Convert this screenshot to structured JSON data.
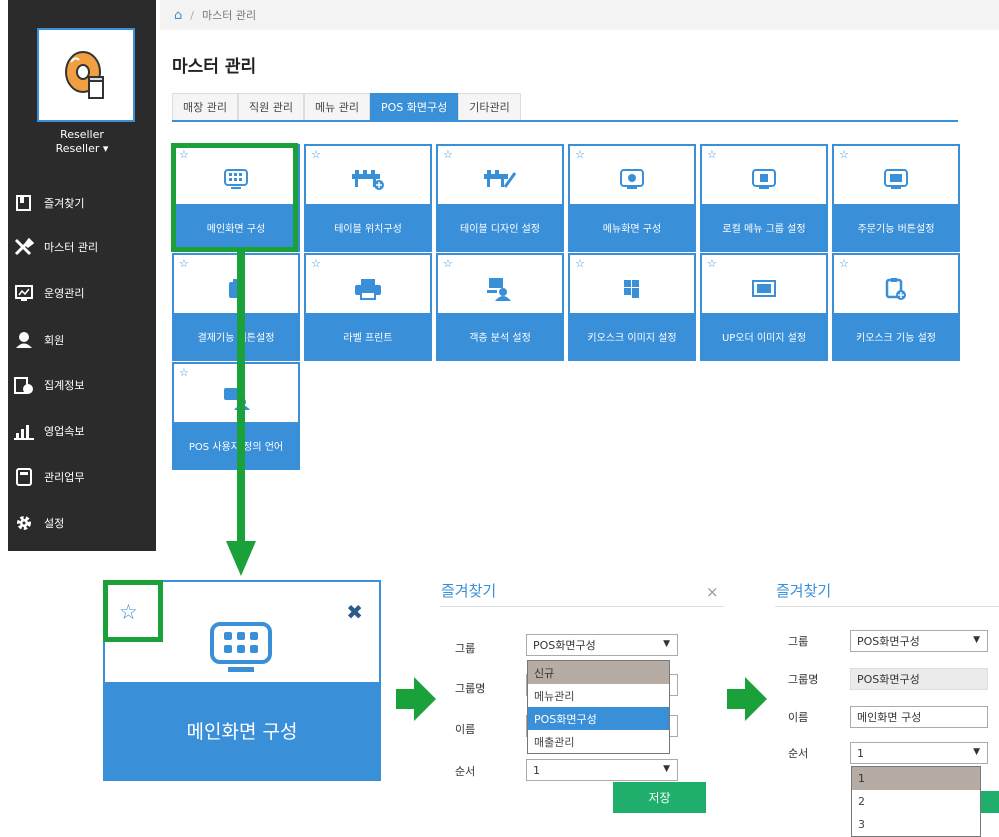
{
  "sidebar": {
    "user_name": "Reseller",
    "user_role": "Reseller ▾",
    "items": [
      {
        "label": "즐겨찾기",
        "icon": "bookmark-icon"
      },
      {
        "label": "마스터 관리",
        "icon": "tools-icon"
      },
      {
        "label": "운영관리",
        "icon": "monitor-chart-icon"
      },
      {
        "label": "회원",
        "icon": "member-icon"
      },
      {
        "label": "집계정보",
        "icon": "clipboard-pie-icon"
      },
      {
        "label": "영업속보",
        "icon": "bar-chart-icon"
      },
      {
        "label": "관리업무",
        "icon": "notebook-icon"
      },
      {
        "label": "설정",
        "icon": "gear-icon"
      }
    ]
  },
  "breadcrumb": {
    "home_icon": "⌂",
    "separator": "/",
    "current": "마스터 관리"
  },
  "page_title": "마스터 관리",
  "tabs": [
    {
      "label": "매장 관리",
      "active": false
    },
    {
      "label": "직원 관리",
      "active": false
    },
    {
      "label": "메뉴 관리",
      "active": false
    },
    {
      "label": "POS 화면구성",
      "active": true
    },
    {
      "label": "기타관리",
      "active": false
    }
  ],
  "tiles": [
    {
      "label": "메인화면 구성",
      "icon": "keypad-monitor-icon"
    },
    {
      "label": "테이블 위치구성",
      "icon": "table-add-icon"
    },
    {
      "label": "테이블 디자인 설정",
      "icon": "table-design-icon"
    },
    {
      "label": "메뉴화면 구성",
      "icon": "menu-screen-icon"
    },
    {
      "label": "로컬 메뉴 그룹 설정",
      "icon": "local-menu-icon"
    },
    {
      "label": "주문기능 버튼설정",
      "icon": "order-button-icon"
    },
    {
      "label": "결제기능 버튼설정",
      "icon": "payment-button-icon"
    },
    {
      "label": "라벨 프린트",
      "icon": "printer-icon"
    },
    {
      "label": "객층 분석 설정",
      "icon": "customer-analysis-icon"
    },
    {
      "label": "키오스크 이미지 설정",
      "icon": "kiosk-image-icon"
    },
    {
      "label": "UP오더 이미지 설정",
      "icon": "up-order-image-icon"
    },
    {
      "label": "키오스크 기능 설정",
      "icon": "kiosk-function-icon"
    },
    {
      "label": "POS 사용자 정의 언어",
      "icon": "pos-language-icon"
    }
  ],
  "tile_star": "☆",
  "zoom_tile": {
    "label": "메인화면 구성",
    "star": "☆",
    "close": "✖"
  },
  "dialog1": {
    "title": "즐겨찾기",
    "close": "×",
    "group_label": "그룹",
    "group_value": "POS화면구성",
    "group_name_label": "그룹명",
    "name_label": "이름",
    "order_label": "순서",
    "order_value": "1",
    "options": [
      "신규",
      "메뉴관리",
      "POS화면구성",
      "매출관리"
    ],
    "save": "저장"
  },
  "dialog2": {
    "title": "즐겨찾기",
    "group_label": "그룹",
    "group_value": "POS화면구성",
    "group_name_label": "그룹명",
    "group_name_value": "POS화면구성",
    "name_label": "이름",
    "name_value": "메인화면 구성",
    "order_label": "순서",
    "order_value": "1",
    "order_options": [
      "1",
      "2",
      "3"
    ]
  },
  "colors": {
    "accent": "#3a8fd9",
    "highlight": "#1aa13a",
    "sidebar": "#2b2b2b",
    "save": "#1fae6b"
  }
}
